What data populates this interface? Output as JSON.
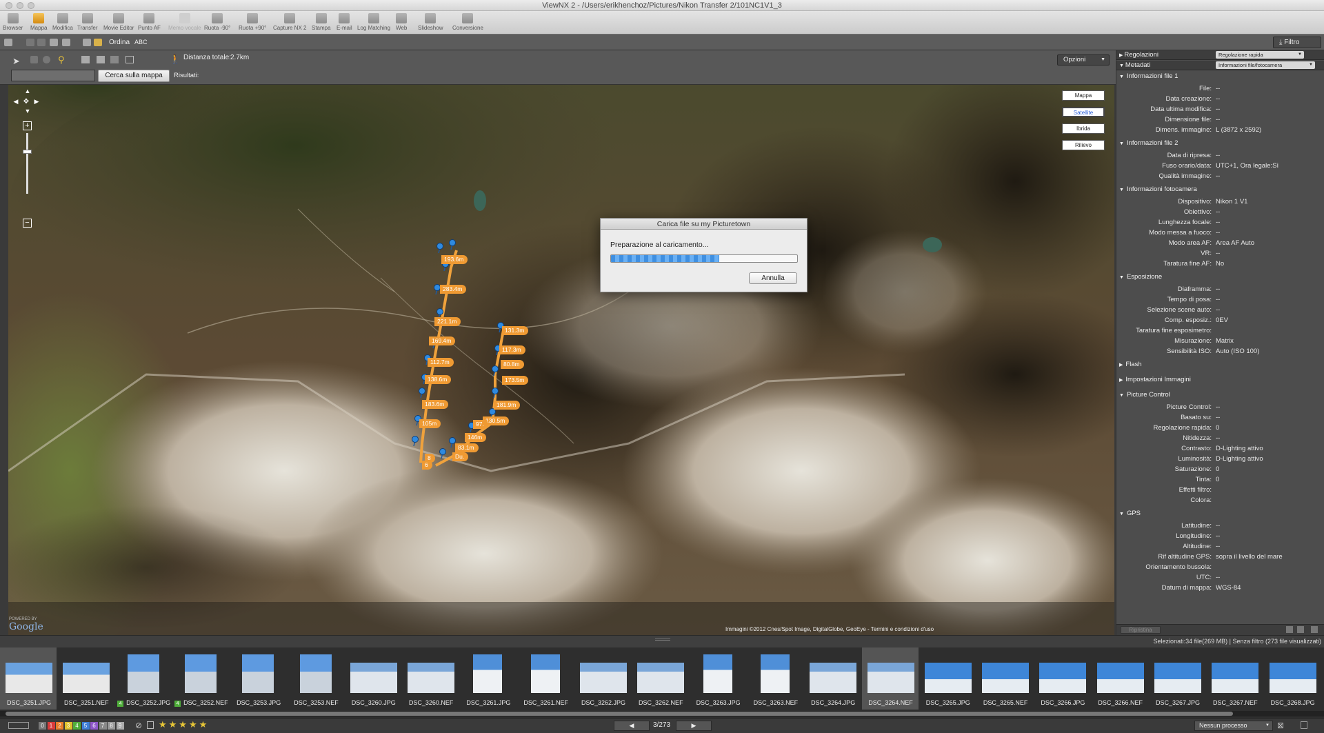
{
  "window": {
    "title": "ViewNX 2 - /Users/erikhenchoz/Pictures/Nikon Transfer 2/101NC1V1_3"
  },
  "toolbar": {
    "items": [
      {
        "label": "Browser",
        "icon": "browser-icon",
        "enabled": true
      },
      {
        "label": "Mappa",
        "icon": "map-icon",
        "enabled": true,
        "active": true
      },
      {
        "label": "Modifica",
        "icon": "edit-icon",
        "enabled": true
      },
      {
        "label": "Transfer",
        "icon": "transfer-icon",
        "enabled": true
      },
      {
        "label": "Movie Editor",
        "icon": "movie-editor-icon",
        "enabled": true
      },
      {
        "label": "Punto AF",
        "icon": "af-point-icon",
        "enabled": true
      },
      {
        "label": "Memo vocale",
        "icon": "voice-memo-icon",
        "enabled": false
      },
      {
        "label": "Ruota -90°",
        "icon": "rotate-left-icon",
        "enabled": true
      },
      {
        "label": "Ruota +90°",
        "icon": "rotate-right-icon",
        "enabled": true
      },
      {
        "label": "Capture NX 2",
        "icon": "capture-nx-icon",
        "enabled": true
      },
      {
        "label": "Stampa",
        "icon": "print-icon",
        "enabled": true
      },
      {
        "label": "E-mail",
        "icon": "email-icon",
        "enabled": true
      },
      {
        "label": "Log Matching",
        "icon": "log-matching-icon",
        "enabled": true
      },
      {
        "label": "Web",
        "icon": "web-icon",
        "enabled": true
      },
      {
        "label": "Slideshow",
        "icon": "slideshow-icon",
        "enabled": true
      },
      {
        "label": "Conversione",
        "icon": "conversion-icon",
        "enabled": true
      }
    ],
    "filter_label": "Filtro"
  },
  "subbar": {
    "sort_label": "Ordina",
    "sort_value": "ABC"
  },
  "mapbar": {
    "distance_label": "Distanza totale:",
    "distance_value": "2.7km",
    "search_placeholder": "",
    "search_button": "Cerca sulla mappa",
    "results_label": "Risultati:",
    "options_label": "Opzioni"
  },
  "map": {
    "types": [
      "Mappa",
      "Satellite",
      "Ibrida",
      "Rilievo"
    ],
    "selected_type": "Satellite",
    "attribution": "Immagini ©2012 Cnes/Spot Image, DigitalGlobe, GeoEye - Termini e condizioni d'uso",
    "logo_powered": "POWERED BY",
    "logo": "Google",
    "track_labels": [
      "193.6m",
      "283.4m",
      "221.1m",
      "169.4m",
      "112.7m",
      "138.6m",
      "183.6m",
      "105m",
      "131.3m",
      "117.3m",
      "80.8m",
      "173.5m",
      "181.9m",
      "130.5m",
      "97.",
      "146m",
      "83.1m",
      "Du.",
      "8",
      "6"
    ]
  },
  "dialog": {
    "title": "Carica file su my Picturetown",
    "message": "Preparazione al caricamento...",
    "progress": 0.58,
    "cancel_label": "Annulla"
  },
  "rpanel": {
    "adjust_label": "Regolazioni",
    "adjust_select": "Regolazione rapida",
    "meta_label": "Metadati",
    "meta_select": "Informazioni file/fotocamera",
    "sections": [
      {
        "title": "Informazioni file 1",
        "rows": [
          [
            "File:",
            "--"
          ],
          [
            "Data creazione:",
            "--"
          ],
          [
            "Data ultima modifica:",
            "--"
          ],
          [
            "Dimensione file:",
            "--"
          ],
          [
            "Dimens. immagine:",
            "L (3872 x 2592)"
          ]
        ]
      },
      {
        "title": "Informazioni file 2",
        "rows": [
          [
            "Data di ripresa:",
            "--"
          ],
          [
            "Fuso orario/data:",
            "UTC+1, Ora legale:Sì"
          ],
          [
            "Qualità immagine:",
            "--"
          ]
        ]
      },
      {
        "title": "Informazioni fotocamera",
        "rows": [
          [
            "Dispositivo:",
            "Nikon 1 V1"
          ],
          [
            "Obiettivo:",
            "--"
          ],
          [
            "Lunghezza focale:",
            "--"
          ],
          [
            "Modo messa a fuoco:",
            "--"
          ],
          [
            "Modo area AF:",
            "Area AF Auto"
          ],
          [
            "VR:",
            "--"
          ],
          [
            "Taratura fine AF:",
            "No"
          ]
        ]
      },
      {
        "title": "Esposizione",
        "rows": [
          [
            "Diaframma:",
            "--"
          ],
          [
            "Tempo di posa:",
            "--"
          ],
          [
            "Selezione scene auto:",
            "--"
          ],
          [
            "Comp. esposiz.:",
            "0EV"
          ],
          [
            "Taratura fine esposimetro:",
            ""
          ],
          [
            "Misurazione:",
            "Matrix"
          ],
          [
            "Sensibilità ISO:",
            "Auto (ISO 100)"
          ]
        ]
      },
      {
        "title": "Flash",
        "collapsed": true,
        "rows": []
      },
      {
        "title": "Impostazioni Immagini",
        "collapsed": true,
        "rows": []
      },
      {
        "title": "Picture Control",
        "rows": [
          [
            "Picture Control:",
            "--"
          ],
          [
            "Basato su:",
            "--"
          ],
          [
            "Regolazione rapida:",
            "0"
          ],
          [
            "Nitidezza:",
            "--"
          ],
          [
            "Contrasto:",
            "D-Lighting attivo"
          ],
          [
            "Luminosità:",
            "D-Lighting attivo"
          ],
          [
            "Saturazione:",
            "0"
          ],
          [
            "Tinta:",
            "0"
          ],
          [
            "Effetti filtro:",
            ""
          ],
          [
            "Colora:",
            ""
          ]
        ]
      },
      {
        "title": "GPS",
        "rows": [
          [
            "Latitudine:",
            "--"
          ],
          [
            "Longitudine:",
            "--"
          ],
          [
            "Altitudine:",
            "--"
          ],
          [
            "Rif altitudine GPS:",
            "sopra il livello del mare"
          ],
          [
            "Orientamento bussola:",
            ""
          ],
          [
            "UTC:",
            "--"
          ],
          [
            "Datum di mappa:",
            "WGS-84"
          ]
        ]
      }
    ],
    "bottom_button": "Ripristina"
  },
  "status": {
    "text": "Selezionati:34 file(269 MB) | Senza filtro (273 file visualizzati)"
  },
  "filmstrip": {
    "thumbs": [
      {
        "name": "DSC_3251.JPG",
        "kind": "sign"
      },
      {
        "name": "DSC_3251.NEF",
        "kind": "sign"
      },
      {
        "name": "DSC_3252.JPG",
        "kind": "portrait",
        "badge": "4"
      },
      {
        "name": "DSC_3252.NEF",
        "kind": "portrait",
        "badge": "4"
      },
      {
        "name": "DSC_3253.JPG",
        "kind": "portrait"
      },
      {
        "name": "DSC_3253.NEF",
        "kind": "portrait"
      },
      {
        "name": "DSC_3260.JPG",
        "kind": "snow"
      },
      {
        "name": "DSC_3260.NEF",
        "kind": "snow"
      },
      {
        "name": "DSC_3261.JPG",
        "kind": "snowp"
      },
      {
        "name": "DSC_3261.NEF",
        "kind": "snowp"
      },
      {
        "name": "DSC_3262.JPG",
        "kind": "snow"
      },
      {
        "name": "DSC_3262.NEF",
        "kind": "snow"
      },
      {
        "name": "DSC_3263.JPG",
        "kind": "snowp"
      },
      {
        "name": "DSC_3263.NEF",
        "kind": "snowp"
      },
      {
        "name": "DSC_3264.JPG",
        "kind": "snow"
      },
      {
        "name": "DSC_3264.NEF",
        "kind": "snow"
      },
      {
        "name": "DSC_3265.JPG",
        "kind": "sky"
      },
      {
        "name": "DSC_3265.NEF",
        "kind": "sky"
      },
      {
        "name": "DSC_3266.JPG",
        "kind": "sky"
      },
      {
        "name": "DSC_3266.NEF",
        "kind": "sky"
      },
      {
        "name": "DSC_3267.JPG",
        "kind": "sky"
      },
      {
        "name": "DSC_3267.NEF",
        "kind": "sky"
      },
      {
        "name": "DSC_3268.JPG",
        "kind": "sky"
      }
    ]
  },
  "bottombar": {
    "labels": [
      "0",
      "1",
      "2",
      "3",
      "4",
      "5",
      "6",
      "7",
      "8",
      "9"
    ],
    "label_colors": [
      "#777777",
      "#d93b3b",
      "#e87d2a",
      "#e0c12c",
      "#4fae3a",
      "#3f7fd9",
      "#8f58c9",
      "#888888",
      "#999999",
      "#aaaaaa"
    ],
    "rating_stars": "★★★★★",
    "page": "3/273",
    "process": "Nessun processo"
  }
}
